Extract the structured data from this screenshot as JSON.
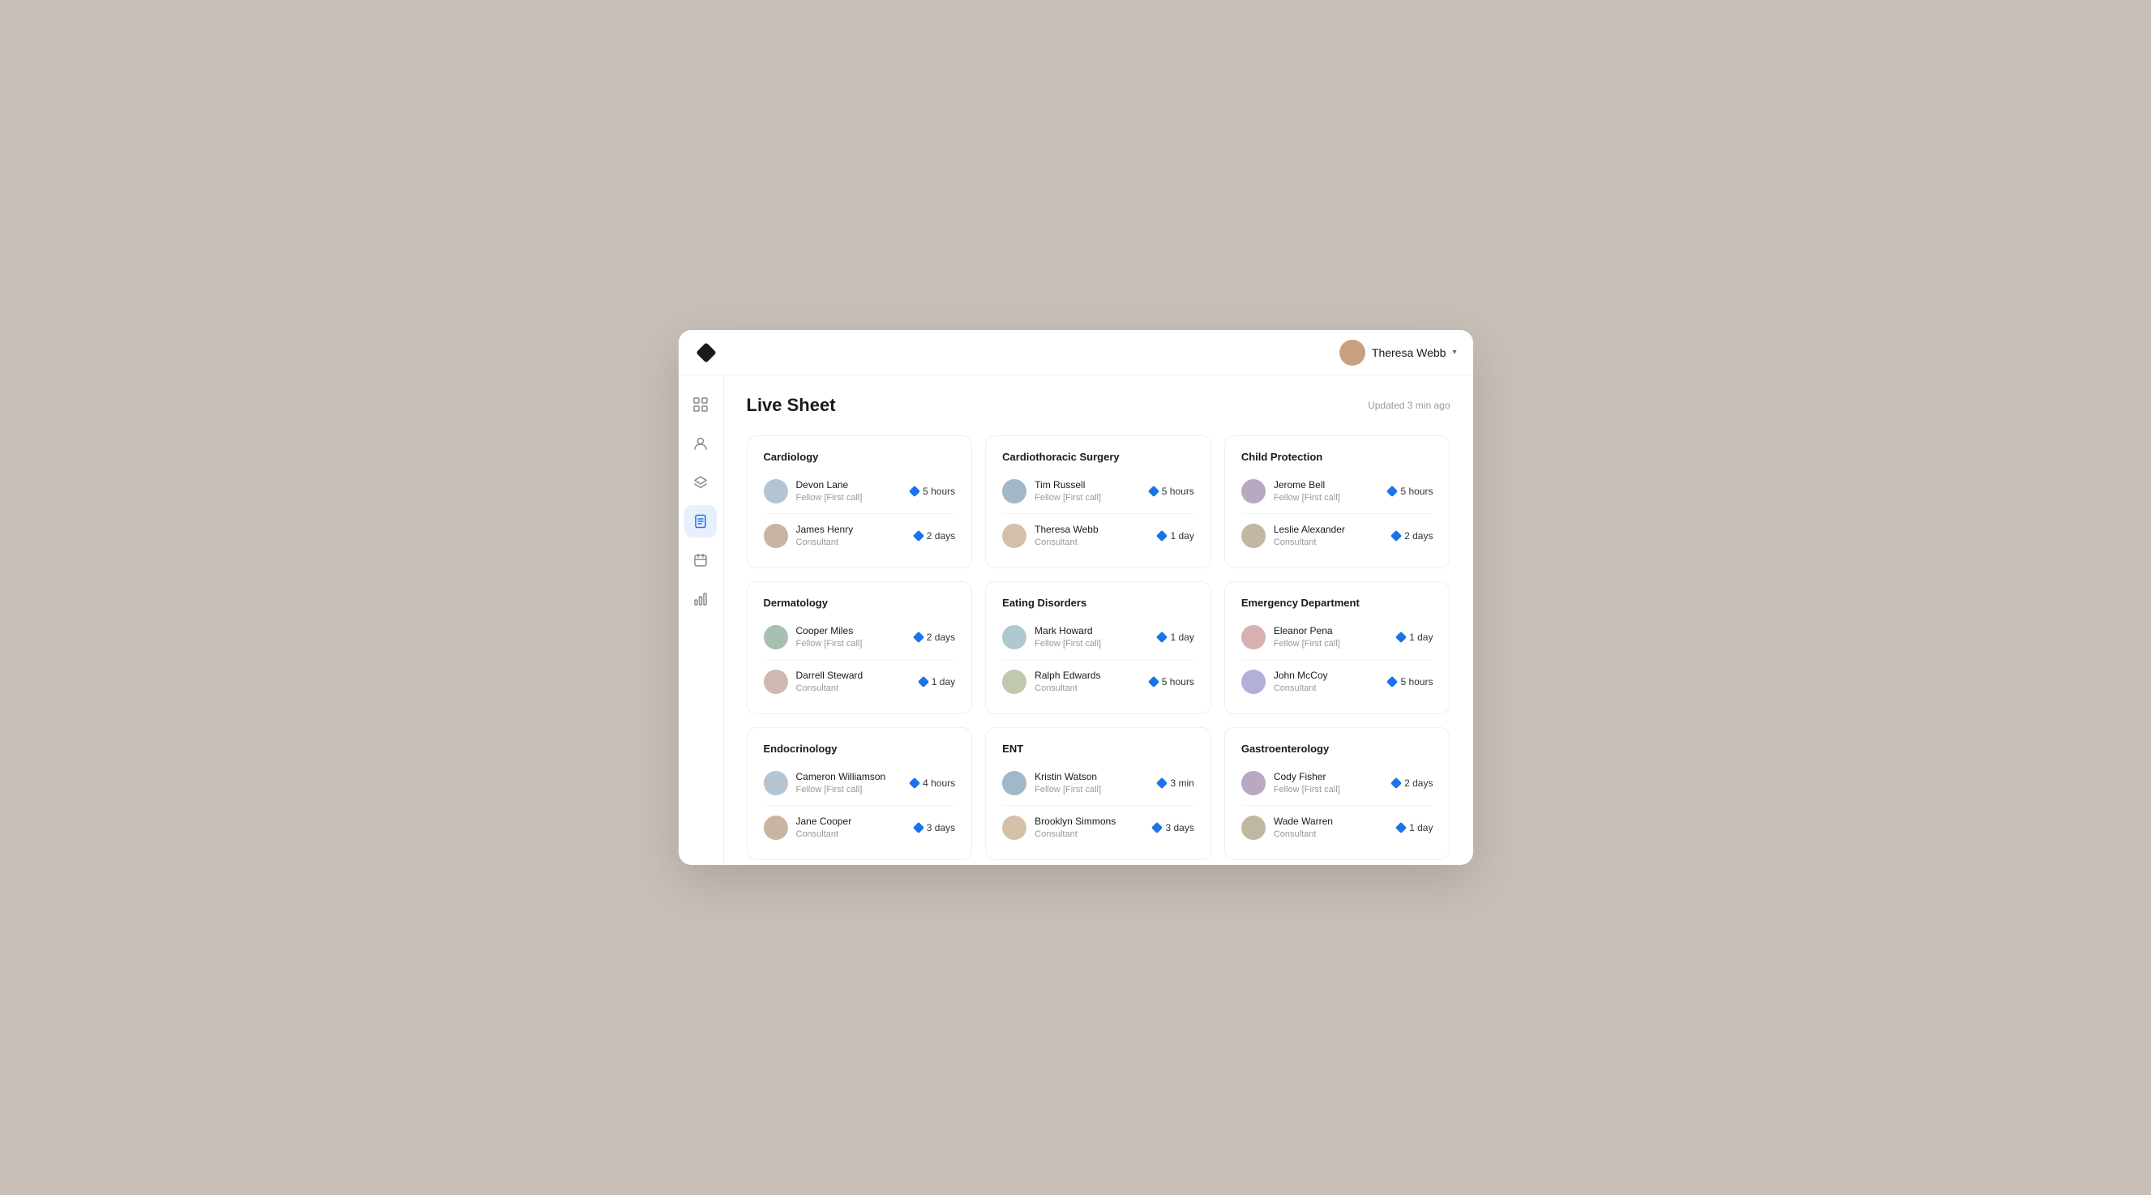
{
  "header": {
    "user_name": "Theresa Webb",
    "chevron": "▾"
  },
  "page": {
    "title": "Live Sheet",
    "updated": "Updated 3 min ago"
  },
  "sidebar": {
    "items": [
      {
        "id": "grid",
        "icon": "⊞",
        "active": false
      },
      {
        "id": "person",
        "icon": "◉",
        "active": false
      },
      {
        "id": "layers",
        "icon": "◈",
        "active": false
      },
      {
        "id": "doc",
        "icon": "🗒",
        "active": true
      },
      {
        "id": "calendar",
        "icon": "▦",
        "active": false
      },
      {
        "id": "chart",
        "icon": "📊",
        "active": false
      }
    ]
  },
  "departments": [
    {
      "name": "Cardiology",
      "people": [
        {
          "name": "Devon Lane",
          "role": "Fellow [First call]",
          "time": "5 hours",
          "av": "av-1"
        },
        {
          "name": "James Henry",
          "role": "Consultant",
          "time": "2 days",
          "av": "av-2"
        }
      ]
    },
    {
      "name": "Cardiothoracic Surgery",
      "people": [
        {
          "name": "Tim Russell",
          "role": "Fellow [First call]",
          "time": "5 hours",
          "av": "av-3"
        },
        {
          "name": "Theresa Webb",
          "role": "Consultant",
          "time": "1 day",
          "av": "av-4"
        }
      ]
    },
    {
      "name": "Child Protection",
      "people": [
        {
          "name": "Jerome Bell",
          "role": "Fellow [First call]",
          "time": "5 hours",
          "av": "av-5"
        },
        {
          "name": "Leslie Alexander",
          "role": "Consultant",
          "time": "2 days",
          "av": "av-6"
        }
      ]
    },
    {
      "name": "Dermatology",
      "people": [
        {
          "name": "Cooper Miles",
          "role": "Fellow [First call]",
          "time": "2 days",
          "av": "av-7"
        },
        {
          "name": "Darrell Steward",
          "role": "Consultant",
          "time": "1 day",
          "av": "av-8"
        }
      ]
    },
    {
      "name": "Eating Disorders",
      "people": [
        {
          "name": "Mark Howard",
          "role": "Fellow [First call]",
          "time": "1 day",
          "av": "av-9"
        },
        {
          "name": "Ralph Edwards",
          "role": "Consultant",
          "time": "5 hours",
          "av": "av-10"
        }
      ]
    },
    {
      "name": "Emergency Department",
      "people": [
        {
          "name": "Eleanor Pena",
          "role": "Fellow [First call]",
          "time": "1 day",
          "av": "av-11"
        },
        {
          "name": "John McCoy",
          "role": "Consultant",
          "time": "5 hours",
          "av": "av-12"
        }
      ]
    },
    {
      "name": "Endocrinology",
      "people": [
        {
          "name": "Cameron Williamson",
          "role": "Fellow [First call]",
          "time": "4 hours",
          "av": "av-1"
        },
        {
          "name": "Jane Cooper",
          "role": "Consultant",
          "time": "3 days",
          "av": "av-2"
        }
      ]
    },
    {
      "name": "ENT",
      "people": [
        {
          "name": "Kristin Watson",
          "role": "Fellow [First call]",
          "time": "3 min",
          "av": "av-3"
        },
        {
          "name": "Brooklyn Simmons",
          "role": "Consultant",
          "time": "3 days",
          "av": "av-4"
        }
      ]
    },
    {
      "name": "Gastroenterology",
      "people": [
        {
          "name": "Cody Fisher",
          "role": "Fellow [First call]",
          "time": "2 days",
          "av": "av-5"
        },
        {
          "name": "Wade Warren",
          "role": "Consultant",
          "time": "1 day",
          "av": "av-6"
        }
      ]
    }
  ]
}
